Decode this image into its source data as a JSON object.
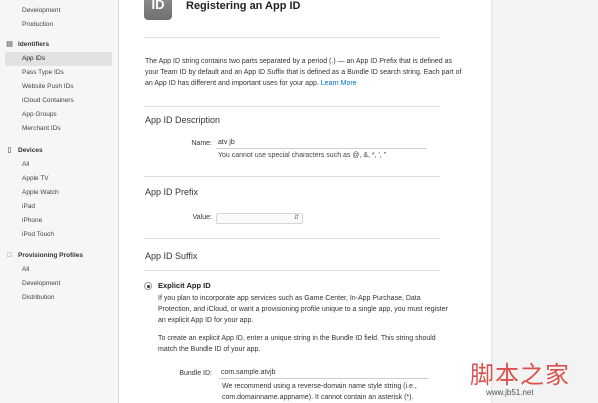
{
  "sidebar": {
    "top_items": [
      {
        "label": "Development"
      },
      {
        "label": "Production"
      }
    ],
    "groups": [
      {
        "heading": "Identifiers",
        "icon": "id-card-icon",
        "items": [
          "App IDs",
          "Pass Type IDs",
          "Website Push IDs",
          "iCloud Containers",
          "App Groups",
          "Merchant IDs"
        ]
      },
      {
        "heading": "Devices",
        "icon": "device-icon",
        "items": [
          "All",
          "Apple TV",
          "Apple Watch",
          "iPad",
          "iPhone",
          "iPod Touch"
        ]
      },
      {
        "heading": "Provisioning Profiles",
        "icon": "document-icon",
        "items": [
          "All",
          "Development",
          "Distribution"
        ]
      }
    ],
    "active_item": "App IDs"
  },
  "header": {
    "icon_text": "ID",
    "title": "Registering an App ID"
  },
  "intro": {
    "text": "The App ID string contains two parts separated by a period (.) — an App ID Prefix that is defined as your Team ID by default and an App ID Suffix that is defined as a Bundle ID search string. Each part of an App ID has different and important uses for your app.",
    "link": "Learn More"
  },
  "description_section": {
    "title": "App ID Description",
    "name_label": "Name:",
    "name_value": "atv jb",
    "hint": "You cannot use special characters such as @, &, *, ', \""
  },
  "prefix_section": {
    "title": "App ID Prefix",
    "value_label": "Value:",
    "select_value": ""
  },
  "suffix_section": {
    "title": "App ID Suffix",
    "option_label": "Explicit App ID",
    "option_desc": "If you plan to incorporate app services such as Game Center, In-App Purchase, Data Protection, and iCloud, or want a provisioning profile unique to a single app, you must register an explicit App ID for your app.",
    "option_desc2": "To create an explicit App ID, enter a unique string in the Bundle ID field. This string should match the Bundle ID of your app.",
    "bundle_label": "Bundle ID:",
    "bundle_value": "com.sample.atvjb",
    "bundle_hint": "We recommend using a reverse-domain name style string (i.e., com.domainname.appname). It cannot contain an asterisk (*)."
  },
  "watermark": {
    "text": "脚本之家",
    "url": "www.jb51.net"
  },
  "colors": {
    "link": "#0070c9",
    "watermark": "#d9534f"
  }
}
